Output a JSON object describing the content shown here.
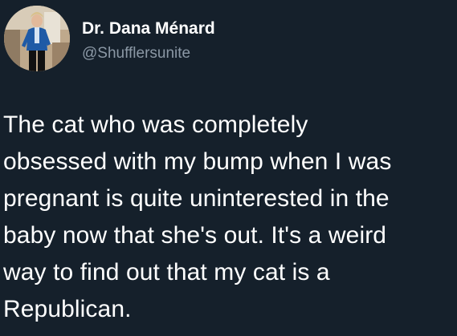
{
  "author": {
    "display_name": "Dr. Dana Ménard",
    "handle": "@Shufflersunite",
    "avatar": "profile-photo"
  },
  "tweet": {
    "text": "The cat who was completely\nobsessed with my bump when I was\npregnant is quite uninterested in the\nbaby now that she's out. It's a weird\nway to find out that my cat is a\nRepublican."
  },
  "colors": {
    "background": "#15202b",
    "text": "#ffffff",
    "secondary_text": "#8b98a5"
  }
}
